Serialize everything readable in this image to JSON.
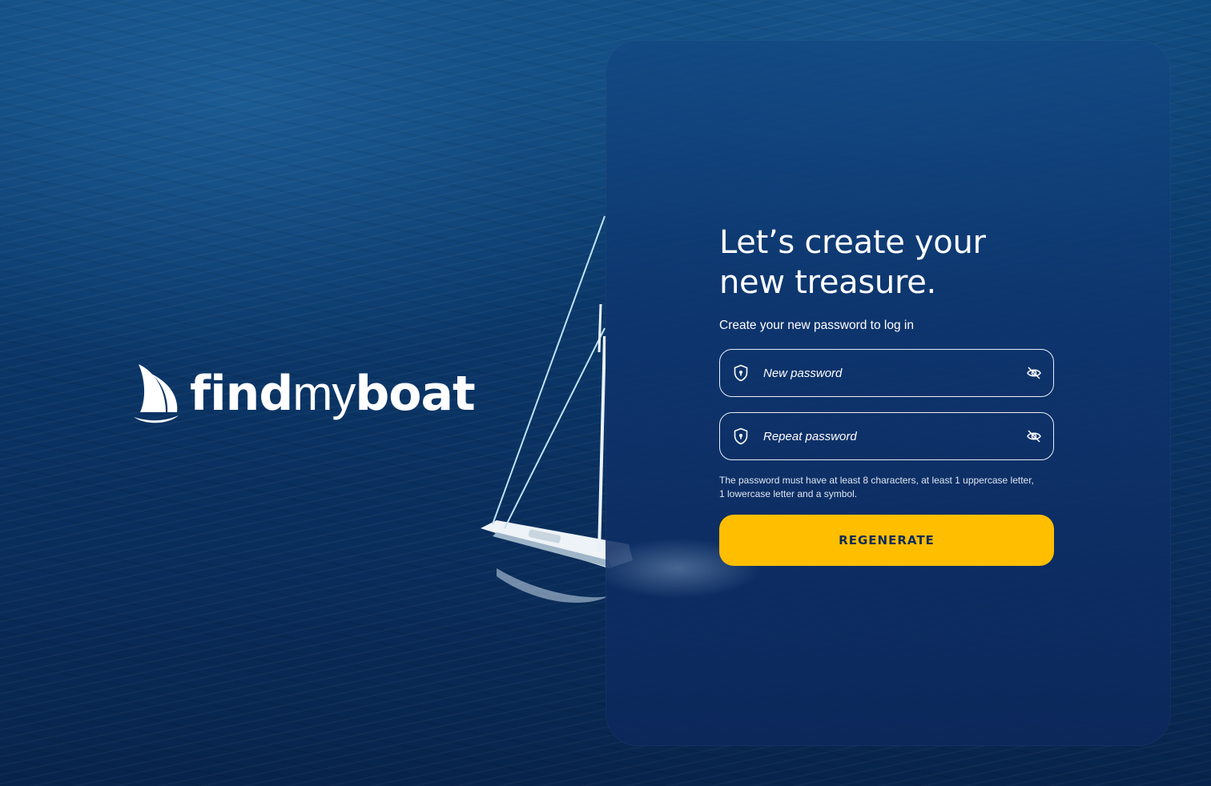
{
  "brand": {
    "name_part1": "find",
    "name_part2": "my",
    "name_part3": "boat",
    "logo_icon": "sailboat-icon"
  },
  "form": {
    "heading_line1": "Let’s create your",
    "heading_line2": "new treasure.",
    "subtitle": "Create your new password to log in",
    "new_password": {
      "placeholder": "New password",
      "value": "",
      "leading_icon": "shield-lock-icon",
      "trailing_icon": "eye-off-icon"
    },
    "repeat_password": {
      "placeholder": "Repeat password",
      "value": "",
      "leading_icon": "shield-lock-icon",
      "trailing_icon": "eye-off-icon"
    },
    "hint": "The password must have at least 8 characters, at least 1 uppercase letter, 1 lowercase letter and a symbol.",
    "submit_label": "REGENERATE"
  },
  "colors": {
    "accent": "#ffbe00",
    "button_text": "#0c2c5a",
    "background": "#0b3a6c",
    "text": "#ffffff"
  }
}
